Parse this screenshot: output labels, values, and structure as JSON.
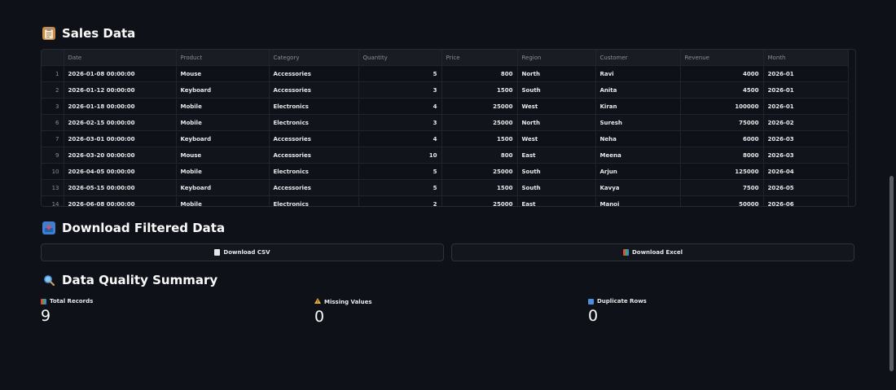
{
  "sales": {
    "title": "Sales Data",
    "icon": "clipboard-icon",
    "columns": [
      "Date",
      "Product",
      "Category",
      "Quantity",
      "Price",
      "Region",
      "Customer",
      "Revenue",
      "Month"
    ],
    "rows": [
      {
        "idx": "1",
        "date": "2026-01-08 00:00:00",
        "product": "Mouse",
        "category": "Accessories",
        "qty": "5",
        "price": "800",
        "region": "North",
        "customer": "Ravi",
        "revenue": "4000",
        "month": "2026-01"
      },
      {
        "idx": "2",
        "date": "2026-01-12 00:00:00",
        "product": "Keyboard",
        "category": "Accessories",
        "qty": "3",
        "price": "1500",
        "region": "South",
        "customer": "Anita",
        "revenue": "4500",
        "month": "2026-01"
      },
      {
        "idx": "3",
        "date": "2026-01-18 00:00:00",
        "product": "Mobile",
        "category": "Electronics",
        "qty": "4",
        "price": "25000",
        "region": "West",
        "customer": "Kiran",
        "revenue": "100000",
        "month": "2026-01"
      },
      {
        "idx": "6",
        "date": "2026-02-15 00:00:00",
        "product": "Mobile",
        "category": "Electronics",
        "qty": "3",
        "price": "25000",
        "region": "North",
        "customer": "Suresh",
        "revenue": "75000",
        "month": "2026-02"
      },
      {
        "idx": "7",
        "date": "2026-03-01 00:00:00",
        "product": "Keyboard",
        "category": "Accessories",
        "qty": "4",
        "price": "1500",
        "region": "West",
        "customer": "Neha",
        "revenue": "6000",
        "month": "2026-03"
      },
      {
        "idx": "9",
        "date": "2026-03-20 00:00:00",
        "product": "Mouse",
        "category": "Accessories",
        "qty": "10",
        "price": "800",
        "region": "East",
        "customer": "Meena",
        "revenue": "8000",
        "month": "2026-03"
      },
      {
        "idx": "10",
        "date": "2026-04-05 00:00:00",
        "product": "Mobile",
        "category": "Electronics",
        "qty": "5",
        "price": "25000",
        "region": "South",
        "customer": "Arjun",
        "revenue": "125000",
        "month": "2026-04"
      },
      {
        "idx": "13",
        "date": "2026-05-15 00:00:00",
        "product": "Keyboard",
        "category": "Accessories",
        "qty": "5",
        "price": "1500",
        "region": "South",
        "customer": "Kavya",
        "revenue": "7500",
        "month": "2026-05"
      },
      {
        "idx": "14",
        "date": "2026-06-08 00:00:00",
        "product": "Mobile",
        "category": "Electronics",
        "qty": "2",
        "price": "25000",
        "region": "East",
        "customer": "Manoj",
        "revenue": "50000",
        "month": "2026-06"
      }
    ]
  },
  "download": {
    "title": "Download Filtered Data",
    "icon": "inbox-tray-icon",
    "csv_label": "Download CSV",
    "csv_icon": "document-icon",
    "excel_label": "Download Excel",
    "excel_icon": "bar-chart-icon"
  },
  "quality": {
    "title": "Data Quality Summary",
    "icon": "magnifier-icon",
    "metrics": [
      {
        "label": "Total Records",
        "value": "9",
        "icon": "bar-chart-icon"
      },
      {
        "label": "Missing Values",
        "value": "0",
        "icon": "warning-icon"
      },
      {
        "label": "Duplicate Rows",
        "value": "0",
        "icon": "repeat-icon"
      }
    ]
  },
  "colors": {
    "background": "#0e1117",
    "table_header": "#1a1c24",
    "text": "#fafafa",
    "muted": "#8b8d96",
    "border": "#262a33"
  }
}
